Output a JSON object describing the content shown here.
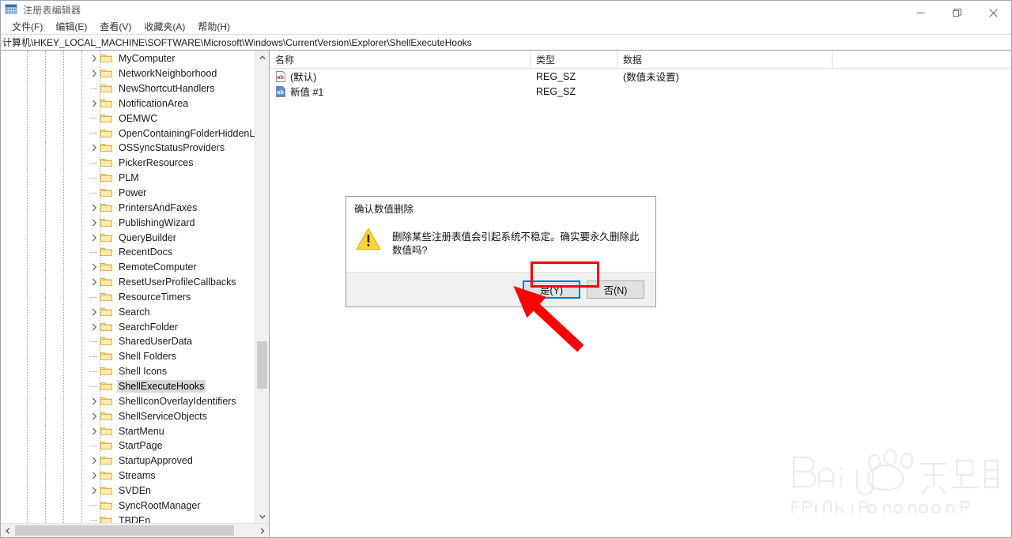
{
  "window": {
    "title": "注册表编辑器",
    "icon": "registry-editor-icon",
    "controls": {
      "minimize": "minimize-icon",
      "maximize": "restore-icon",
      "close": "close-icon"
    }
  },
  "menubar": {
    "items": [
      {
        "label": "文件(F)",
        "name": "menu-file"
      },
      {
        "label": "编辑(E)",
        "name": "menu-edit"
      },
      {
        "label": "查看(V)",
        "name": "menu-view"
      },
      {
        "label": "收藏夹(A)",
        "name": "menu-favorites"
      },
      {
        "label": "帮助(H)",
        "name": "menu-help"
      }
    ]
  },
  "address": {
    "path": "计算机\\HKEY_LOCAL_MACHINE\\SOFTWARE\\Microsoft\\Windows\\CurrentVersion\\Explorer\\ShellExecuteHooks"
  },
  "tree": {
    "items": [
      {
        "label": "MyComputer",
        "expandable": true,
        "selected": false
      },
      {
        "label": "NetworkNeighborhood",
        "expandable": true,
        "selected": false
      },
      {
        "label": "NewShortcutHandlers",
        "expandable": false,
        "selected": false
      },
      {
        "label": "NotificationArea",
        "expandable": true,
        "selected": false
      },
      {
        "label": "OEMWC",
        "expandable": false,
        "selected": false
      },
      {
        "label": "OpenContainingFolderHiddenLis",
        "expandable": false,
        "selected": false
      },
      {
        "label": "OSSyncStatusProviders",
        "expandable": true,
        "selected": false
      },
      {
        "label": "PickerResources",
        "expandable": false,
        "selected": false
      },
      {
        "label": "PLM",
        "expandable": false,
        "selected": false
      },
      {
        "label": "Power",
        "expandable": false,
        "selected": false
      },
      {
        "label": "PrintersAndFaxes",
        "expandable": true,
        "selected": false
      },
      {
        "label": "PublishingWizard",
        "expandable": true,
        "selected": false
      },
      {
        "label": "QueryBuilder",
        "expandable": true,
        "selected": false
      },
      {
        "label": "RecentDocs",
        "expandable": false,
        "selected": false
      },
      {
        "label": "RemoteComputer",
        "expandable": true,
        "selected": false
      },
      {
        "label": "ResetUserProfileCallbacks",
        "expandable": true,
        "selected": false
      },
      {
        "label": "ResourceTimers",
        "expandable": false,
        "selected": false
      },
      {
        "label": "Search",
        "expandable": true,
        "selected": false
      },
      {
        "label": "SearchFolder",
        "expandable": true,
        "selected": false
      },
      {
        "label": "SharedUserData",
        "expandable": false,
        "selected": false
      },
      {
        "label": "Shell Folders",
        "expandable": false,
        "selected": false
      },
      {
        "label": "Shell Icons",
        "expandable": false,
        "selected": false
      },
      {
        "label": "ShellExecuteHooks",
        "expandable": false,
        "selected": true
      },
      {
        "label": "ShellIconOverlayIdentifiers",
        "expandable": true,
        "selected": false
      },
      {
        "label": "ShellServiceObjects",
        "expandable": true,
        "selected": false
      },
      {
        "label": "StartMenu",
        "expandable": true,
        "selected": false
      },
      {
        "label": "StartPage",
        "expandable": false,
        "selected": false
      },
      {
        "label": "StartupApproved",
        "expandable": true,
        "selected": false
      },
      {
        "label": "Streams",
        "expandable": true,
        "selected": false
      },
      {
        "label": "SVDEn",
        "expandable": true,
        "selected": false
      },
      {
        "label": "SyncRootManager",
        "expandable": false,
        "selected": false
      },
      {
        "label": "TBDEn",
        "expandable": false,
        "selected": false
      }
    ]
  },
  "list": {
    "columns": [
      "名称",
      "类型",
      "数据"
    ],
    "rows": [
      {
        "name": "(默认)",
        "type": "REG_SZ",
        "data": "(数值未设置)",
        "icon": "string-value-icon",
        "selected": false
      },
      {
        "name": "新值 #1",
        "type": "REG_SZ",
        "data": "",
        "icon": "string-value-icon-selected",
        "selected": true
      }
    ]
  },
  "dialog": {
    "title": "确认数值删除",
    "icon": "warning-icon",
    "message": "删除某些注册表值会引起系统不稳定。确实要永久删除此数值吗?",
    "buttons": [
      {
        "label": "是(Y)",
        "name": "yes-button",
        "default": true
      },
      {
        "label": "否(N)",
        "name": "no-button",
        "default": false
      }
    ]
  },
  "annotation": {
    "color": "#fe0000",
    "target": "yes-button"
  },
  "watermark": {
    "brand": "Baidu",
    "suffix": "经验",
    "url": "jingyan.baidu.com"
  }
}
